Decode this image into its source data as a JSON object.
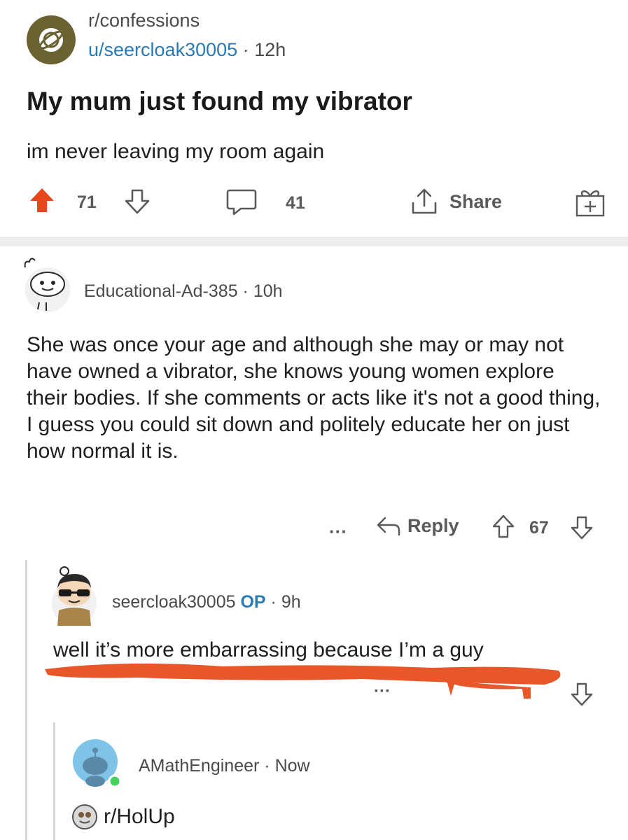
{
  "post": {
    "subreddit": "r/confessions",
    "author": "u/seercloak30005",
    "time_sep": "·",
    "time": "12h",
    "title": "My mum just found my vibrator",
    "body": "im never leaving my room again",
    "upvotes": "71",
    "comments": "41",
    "share_label": "Share"
  },
  "comments": [
    {
      "author": "Educational-Ad-385",
      "time_sep": "·",
      "time": "10h",
      "body": "She was once your age and although she may or may not have owned a vibrator, she knows young women explore their bodies. If she comments or acts like it's not a good thing, I guess you could sit down and politely educate her on just how normal it is.",
      "more": "···",
      "reply_label": "Reply",
      "score": "67"
    },
    {
      "author": "seercloak30005",
      "op_badge": "OP",
      "time_sep": "·",
      "time": "9h",
      "body": "well it’s more embarrassing because I’m a guy",
      "more": "···"
    },
    {
      "author": "AMathEngineer",
      "time_sep": "·",
      "time": "Now",
      "subreddit_link": "r/HolUp"
    }
  ],
  "colors": {
    "upvote_active": "#e8461c",
    "link_blue": "#2a7ab5",
    "scribble": "#e8572a",
    "divider": "#ececec"
  }
}
